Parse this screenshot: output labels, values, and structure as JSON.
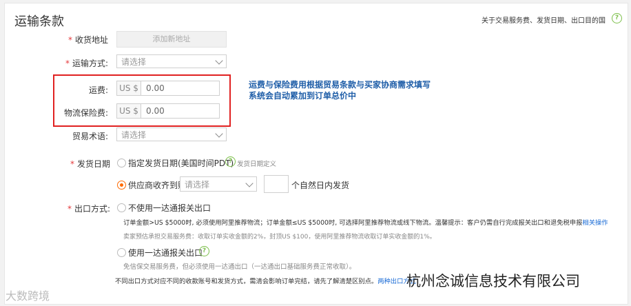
{
  "header": {
    "title": "运输条款",
    "help_text": "关于交易服务费、发货日期、出口目的国",
    "help_icon": "?"
  },
  "address": {
    "label": "收货地址",
    "button": "添加新地址"
  },
  "shipping_method": {
    "label": "运输方式:",
    "placeholder": "请选择"
  },
  "freight": {
    "label": "运费:",
    "currency": "US $",
    "value": "0.00"
  },
  "insurance": {
    "label": "物流保险费:",
    "currency": "US $",
    "value": "0.00"
  },
  "callout": {
    "line1": "运费与保险费用根据贸易条款与买家协商需求填写",
    "line2": "系统会自动累加到订单总价中"
  },
  "trade_term": {
    "label": "贸易术语:",
    "placeholder": "请选择"
  },
  "ship_date": {
    "label": "发货日期",
    "option1": "指定发货日期(美国时间PDT)",
    "option1_help": "发货日期定义",
    "option2": "供应商收齐到账",
    "option2_select": "请选择",
    "option2_suffix": "个自然日内发货"
  },
  "export": {
    "label": "出口方式:",
    "option1": "不使用一达通报关出口",
    "option1_desc": "订单金额>US $5000时, 必须使用阿里推荐物流；订单金额≤US $5000时, 可选择阿里推荐物流或线下物流。温馨提示：客户仍需自行完成报关出口和退免税申报",
    "option1_link": "相关操作",
    "option1_fee": "卖家预估承担交易服务费：收取订单实收金额的2%，封顶US $100，使用阿里推荐物流收取订单实收金额的1%。",
    "option2": "使用一达通报关出口",
    "option2_desc": "免信保交易服务费，但必须使用一达通出口（一达通出口基础服务费正常收取）。",
    "footer_text": "不同出口方式对应不同的收款账号和发货方式，需清会影响订单完结，请先了解清楚区别点。",
    "footer_link": "两种出口方式"
  },
  "watermarks": {
    "left": "大数跨境",
    "right": "杭州念诚信息技术有限公司"
  }
}
